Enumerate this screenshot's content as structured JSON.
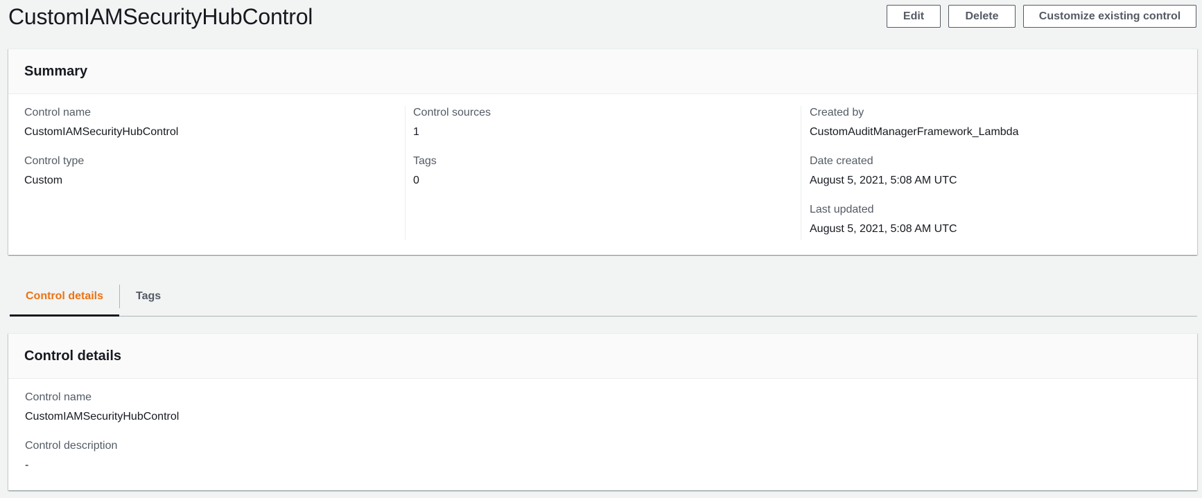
{
  "header": {
    "title": "CustomIAMSecurityHubControl",
    "actions": {
      "edit": "Edit",
      "delete": "Delete",
      "customize": "Customize existing control"
    }
  },
  "summary": {
    "title": "Summary",
    "control_name": {
      "label": "Control name",
      "value": "CustomIAMSecurityHubControl"
    },
    "control_type": {
      "label": "Control type",
      "value": "Custom"
    },
    "control_sources": {
      "label": "Control sources",
      "value": "1"
    },
    "tags": {
      "label": "Tags",
      "value": "0"
    },
    "created_by": {
      "label": "Created by",
      "value": "CustomAuditManagerFramework_Lambda"
    },
    "date_created": {
      "label": "Date created",
      "value": "August 5, 2021, 5:08 AM UTC"
    },
    "last_updated": {
      "label": "Last updated",
      "value": "August 5, 2021, 5:08 AM UTC"
    }
  },
  "tabs": [
    {
      "label": "Control details",
      "active": true
    },
    {
      "label": "Tags",
      "active": false
    }
  ],
  "details": {
    "title": "Control details",
    "control_name": {
      "label": "Control name",
      "value": "CustomIAMSecurityHubControl"
    },
    "control_description": {
      "label": "Control description",
      "value": "-"
    }
  },
  "colors": {
    "accent_active_tab": "#ec7211",
    "text_primary": "#16191f",
    "text_secondary": "#545b64",
    "background": "#f2f3f3"
  }
}
